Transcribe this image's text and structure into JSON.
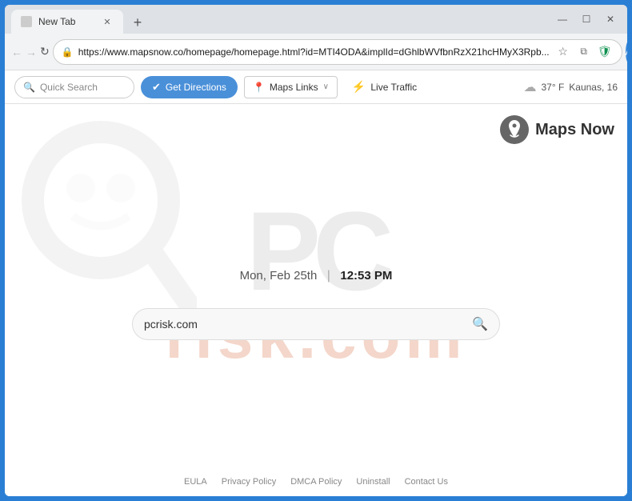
{
  "browser": {
    "tab_label": "New Tab",
    "url": "https://www.mapsnow.co/homepage/homepage.html?id=MTI4ODA&implId=dGhlbWVfbnRzX21hcHMyX3Rpb...",
    "new_tab_icon": "+",
    "window_controls": {
      "minimize": "—",
      "maximize": "☐",
      "close": "✕"
    },
    "nav": {
      "back": "←",
      "forward": "→",
      "refresh": "↻"
    }
  },
  "toolbar": {
    "quick_search_placeholder": "Quick Search",
    "get_directions_label": "Get Directions",
    "maps_links_label": "Maps Links",
    "live_traffic_label": "Live Traffic",
    "weather_temp": "37° F",
    "weather_city": "Kaunas, 16",
    "chevron_down": "∨"
  },
  "page": {
    "brand_name": "Maps Now",
    "date": "Mon, Feb 25th",
    "time": "12:53 PM",
    "search_value": "pcrisk.com",
    "watermark_top": "PC",
    "watermark_bottom": "risk.com",
    "footer_links": [
      "EULA",
      "Privacy Policy",
      "DMCA Policy",
      "Uninstall",
      "Contact Us"
    ]
  },
  "icons": {
    "search": "🔍",
    "directions": "✔",
    "map_pin": "📍",
    "traffic": "⚡",
    "weather_cloud": "☁",
    "lock": "🔒",
    "star": "☆",
    "shield": "🛡",
    "account": "A",
    "menu": "⋮",
    "location_person": "👤"
  }
}
